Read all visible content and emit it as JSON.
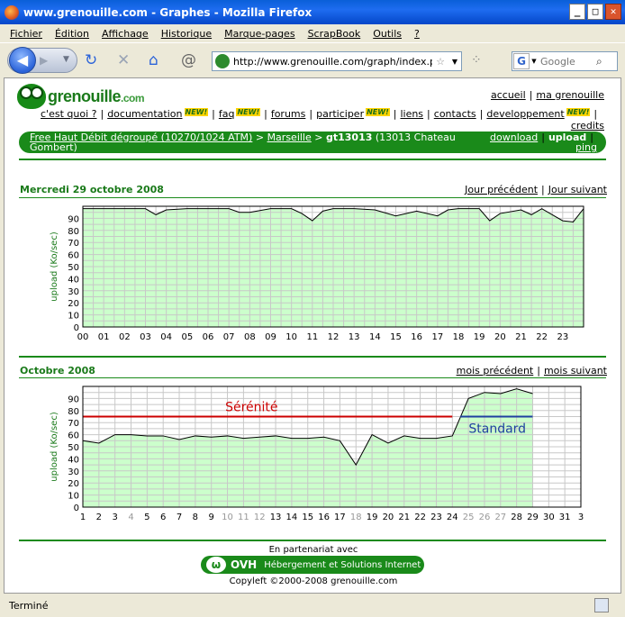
{
  "window": {
    "title": "www.grenouille.com - Graphes - Mozilla Firefox",
    "btn_min": "_",
    "btn_max": "□",
    "btn_close": "✕"
  },
  "menu": [
    "Fichier",
    "Édition",
    "Affichage",
    "Historique",
    "Marque-pages",
    "ScrapBook",
    "Outils",
    "?"
  ],
  "toolbar": {
    "url": "http://www.grenouille.com/graph/index.ph",
    "search_placeholder": "Google"
  },
  "status": "Terminé",
  "site": {
    "logo_main": "grenouille",
    "logo_tld": ".com",
    "top_links": [
      "accueil",
      "ma grenouille"
    ],
    "nav": [
      {
        "label": "c'est quoi ?",
        "new": false
      },
      {
        "label": "documentation",
        "new": true
      },
      {
        "label": "faq",
        "new": true
      },
      {
        "label": "forums",
        "new": false
      },
      {
        "label": "participer",
        "new": true
      },
      {
        "label": "liens",
        "new": false
      },
      {
        "label": "contacts",
        "new": false
      },
      {
        "label": "developpement",
        "new": true
      }
    ],
    "new_badge": "NEW!",
    "credits": "credits",
    "path_provider": "Free Haut Débit dégroupé (10270/1024 ATM)",
    "path_arrow": ">",
    "path_city": "Marseille",
    "path_node": "gt13013",
    "path_node_desc": "(13013 Chateau Gombert)",
    "link_download": "download",
    "link_upload": "upload",
    "link_ping": "ping",
    "partner_text": "En partenariat avec",
    "ovh_name": "OVH",
    "ovh_tagline": "Hébergement et Solutions Internet",
    "copyleft": "Copyleft ©2000-2008 grenouille.com"
  },
  "chart_data": [
    {
      "type": "area",
      "title": "Mercredi 29 octobre 2008",
      "nav_prev": "Jour précédent",
      "nav_next": "Jour suivant",
      "ylabel": "upload (Ko/sec)",
      "xlabel": "",
      "ylim": [
        0,
        100
      ],
      "yticks": [
        0,
        10,
        20,
        30,
        40,
        50,
        60,
        70,
        80,
        90
      ],
      "categories": [
        "00",
        "01",
        "02",
        "03",
        "04",
        "05",
        "06",
        "07",
        "08",
        "09",
        "10",
        "11",
        "12",
        "13",
        "14",
        "15",
        "16",
        "17",
        "18",
        "19",
        "20",
        "21",
        "22",
        "23"
      ],
      "x": [
        0,
        1,
        2,
        3,
        3.5,
        4,
        5,
        6,
        7,
        7.5,
        8,
        9,
        10,
        10.5,
        11,
        11.5,
        12,
        13,
        14,
        15,
        16,
        17,
        17.5,
        18,
        19,
        19.5,
        20,
        21,
        21.5,
        22,
        22.5,
        23,
        23.5,
        24
      ],
      "values": [
        98,
        98,
        98,
        98,
        93,
        97,
        98,
        98,
        98,
        95,
        95,
        98,
        98,
        94,
        88,
        96,
        98,
        98,
        97,
        92,
        96,
        92,
        97,
        98,
        98,
        88,
        94,
        97,
        93,
        98,
        93,
        88,
        87,
        98
      ],
      "fill": "#ccffcc",
      "line": "#000000",
      "grid": true
    },
    {
      "type": "area",
      "title": "Octobre 2008",
      "nav_prev": "mois précédent",
      "nav_next": "mois suivant",
      "ylabel": "upload (Ko/sec)",
      "xlabel": "",
      "ylim": [
        0,
        100
      ],
      "yticks": [
        0,
        10,
        20,
        30,
        40,
        50,
        60,
        70,
        80,
        90
      ],
      "categories": [
        "1",
        "2",
        "3",
        "4",
        "5",
        "6",
        "7",
        "8",
        "9",
        "10",
        "11",
        "12",
        "13",
        "14",
        "15",
        "16",
        "17",
        "18",
        "19",
        "20",
        "21",
        "22",
        "23",
        "24",
        "25",
        "26",
        "27",
        "28",
        "29",
        "30",
        "31",
        "3"
      ],
      "greyed_categories": [
        "4",
        "10",
        "11",
        "12",
        "18",
        "25",
        "26",
        "27"
      ],
      "x": [
        1,
        2,
        3,
        4,
        5,
        6,
        7,
        8,
        9,
        10,
        11,
        12,
        13,
        14,
        15,
        16,
        17,
        18,
        19,
        20,
        21,
        22,
        23,
        24,
        25,
        26,
        27,
        28,
        29
      ],
      "values": [
        55,
        53,
        60,
        60,
        59,
        59,
        56,
        59,
        58,
        59,
        57,
        58,
        59,
        57,
        57,
        58,
        55,
        35,
        60,
        53,
        59,
        57,
        57,
        59,
        90,
        95,
        94,
        98,
        94
      ],
      "thresholds": [
        {
          "name": "Sérénité",
          "value": 75,
          "from": 1,
          "to": 24,
          "color": "#cc0000"
        },
        {
          "name": "Standard",
          "value": 75,
          "from": 24.5,
          "to": 29,
          "color": "#1f3fa0"
        }
      ],
      "fill": "#ccffcc",
      "line": "#000000",
      "grid": true
    }
  ]
}
